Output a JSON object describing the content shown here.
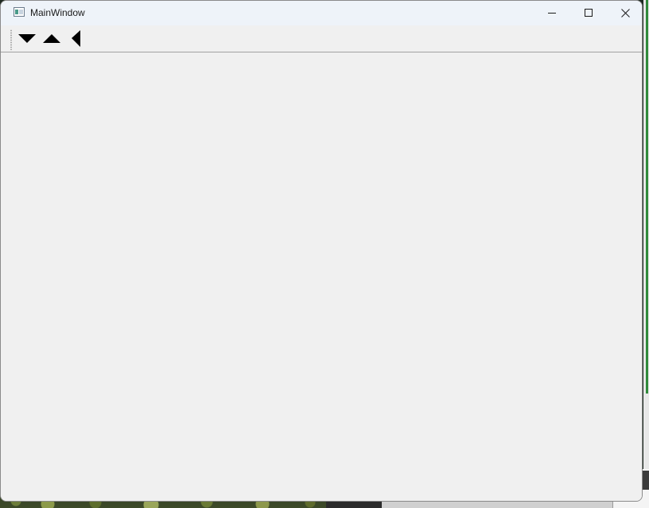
{
  "window": {
    "title": "MainWindow"
  },
  "titlebar_buttons": {
    "minimize_icon": "minimize-icon",
    "maximize_icon": "maximize-icon",
    "close_icon": "close-icon"
  },
  "toolbar": {
    "actions": [
      {
        "icon": "arrow-down-icon"
      },
      {
        "icon": "arrow-up-icon"
      },
      {
        "icon": "arrow-left-icon"
      }
    ]
  },
  "colors": {
    "titlebar_bg": "#eef3f9",
    "window_bg": "#f0f0f0",
    "icon_color": "#000000"
  }
}
